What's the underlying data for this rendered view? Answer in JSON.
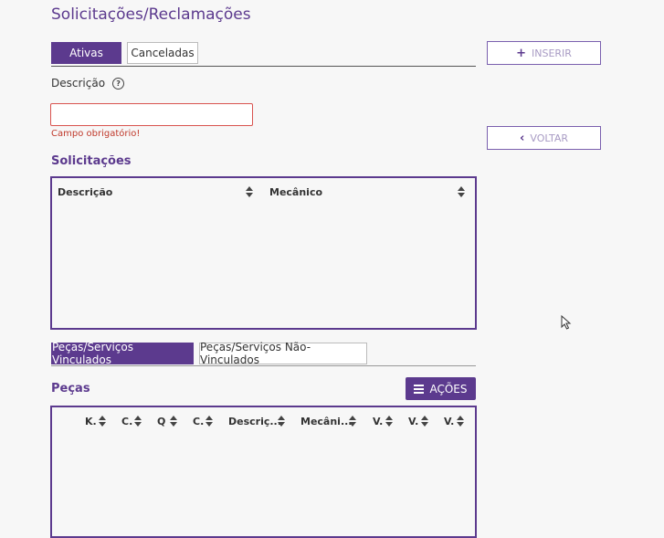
{
  "page": {
    "title": "Solicitações/Reclamações"
  },
  "status_tabs": [
    {
      "label": "Ativas",
      "active": true
    },
    {
      "label": "Canceladas",
      "active": false
    }
  ],
  "actions": {
    "insert_label": "INSERIR",
    "back_label": "VOLTAR"
  },
  "form": {
    "description_label": "Descrição",
    "description_value": "",
    "error_message": "Campo obrigatório!"
  },
  "solicitations": {
    "title": "Solicitações",
    "columns": [
      "Descrição",
      "Mecânico"
    ]
  },
  "link_tabs": [
    {
      "label": "Peças/Serviços Vinculados",
      "active": true
    },
    {
      "label": "Peças/Serviços Não-Vinculados",
      "active": false
    }
  ],
  "parts": {
    "title": "Peças",
    "actions_label": "AÇÕES",
    "columns": [
      "K.",
      "C.",
      "Q",
      "C.",
      "Descriç...",
      "Mecâni...",
      "V.",
      "V.",
      "V."
    ]
  },
  "colors": {
    "accent": "#5c3a8e",
    "error": "#d9534f"
  }
}
